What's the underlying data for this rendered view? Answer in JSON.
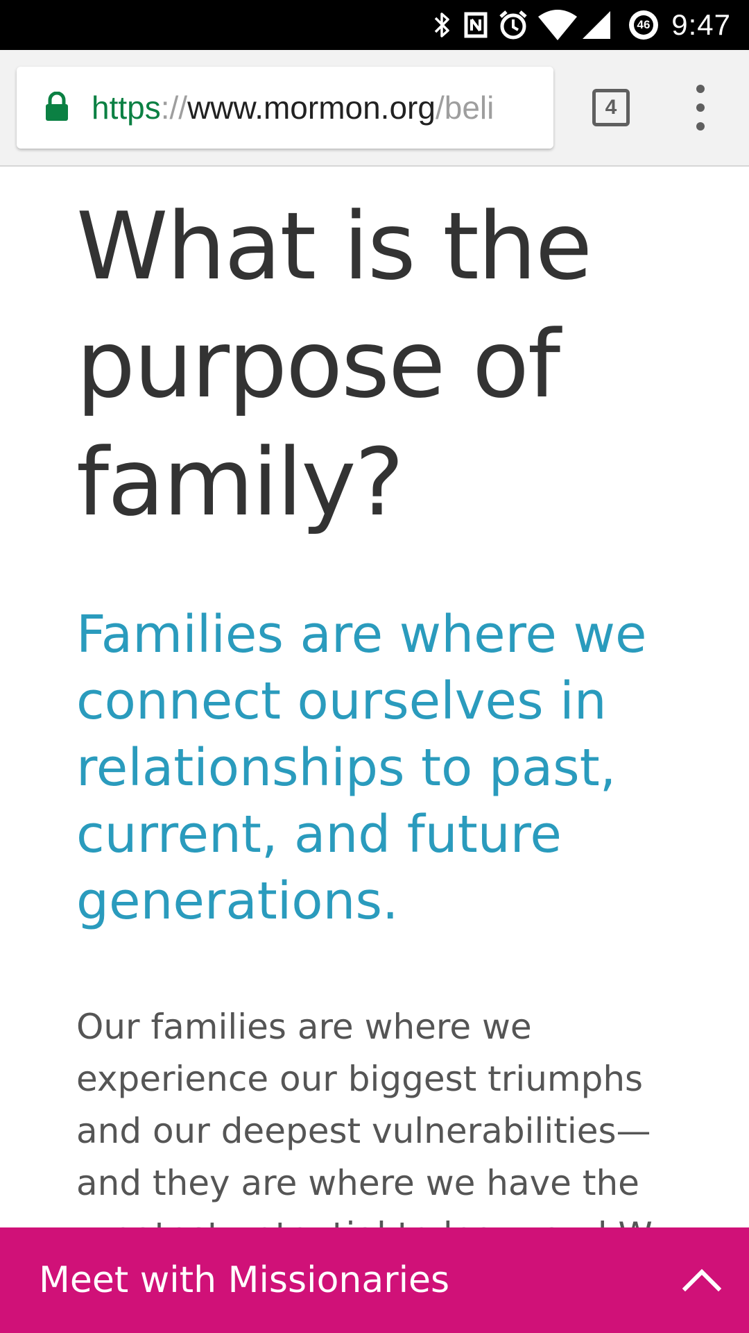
{
  "status_bar": {
    "time": "9:47",
    "icons": [
      "bluetooth-icon",
      "nfc-icon",
      "alarm-icon",
      "wifi-icon",
      "cell-signal-icon",
      "data-saver-icon"
    ],
    "data_badge": "46"
  },
  "browser": {
    "url": {
      "scheme": "https",
      "separator": "://",
      "host": "www.mormon.org",
      "path": "/beli"
    },
    "tab_count": "4",
    "secure_color": "#0b8043"
  },
  "article": {
    "title": "What is the purpose of family?",
    "subtitle": "Families are where we connect ourselves in relationships to past, current, and future generations.",
    "body": "Our families are where we experience our biggest triumphs and our deepest vulnerabilities—and they are where we have the greatest potential to learn and W"
  },
  "cta": {
    "label": "Meet with Missionaries",
    "color": "#d01178"
  },
  "colors": {
    "title": "#333333",
    "subtitle": "#2a9bbd",
    "body": "#555555"
  }
}
